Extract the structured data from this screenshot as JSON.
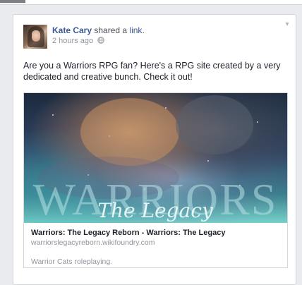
{
  "post": {
    "author": "Kate Cary",
    "action": "shared a",
    "object": "link",
    "period": ".",
    "timestamp": "2 hours ago",
    "message": "Are you a Warriors RPG fan? Here's a RPG site created by a very dedicated and creative bunch. Check it out!",
    "privacy_icon": "globe-icon",
    "menu_icon": "chevron-down-icon"
  },
  "link_preview": {
    "image_title": "WARRIORS",
    "image_subtitle": "The Legacy",
    "title": "Warriors: The Legacy Reborn - Warriors: The Legacy",
    "domain": "warriorslegacyreborn.wikifoundry.com",
    "description": "Warrior Cats roleplaying."
  },
  "colors": {
    "link_blue": "#3b5998",
    "meta_gray": "#90949c",
    "page_background": "#e9ebee"
  }
}
